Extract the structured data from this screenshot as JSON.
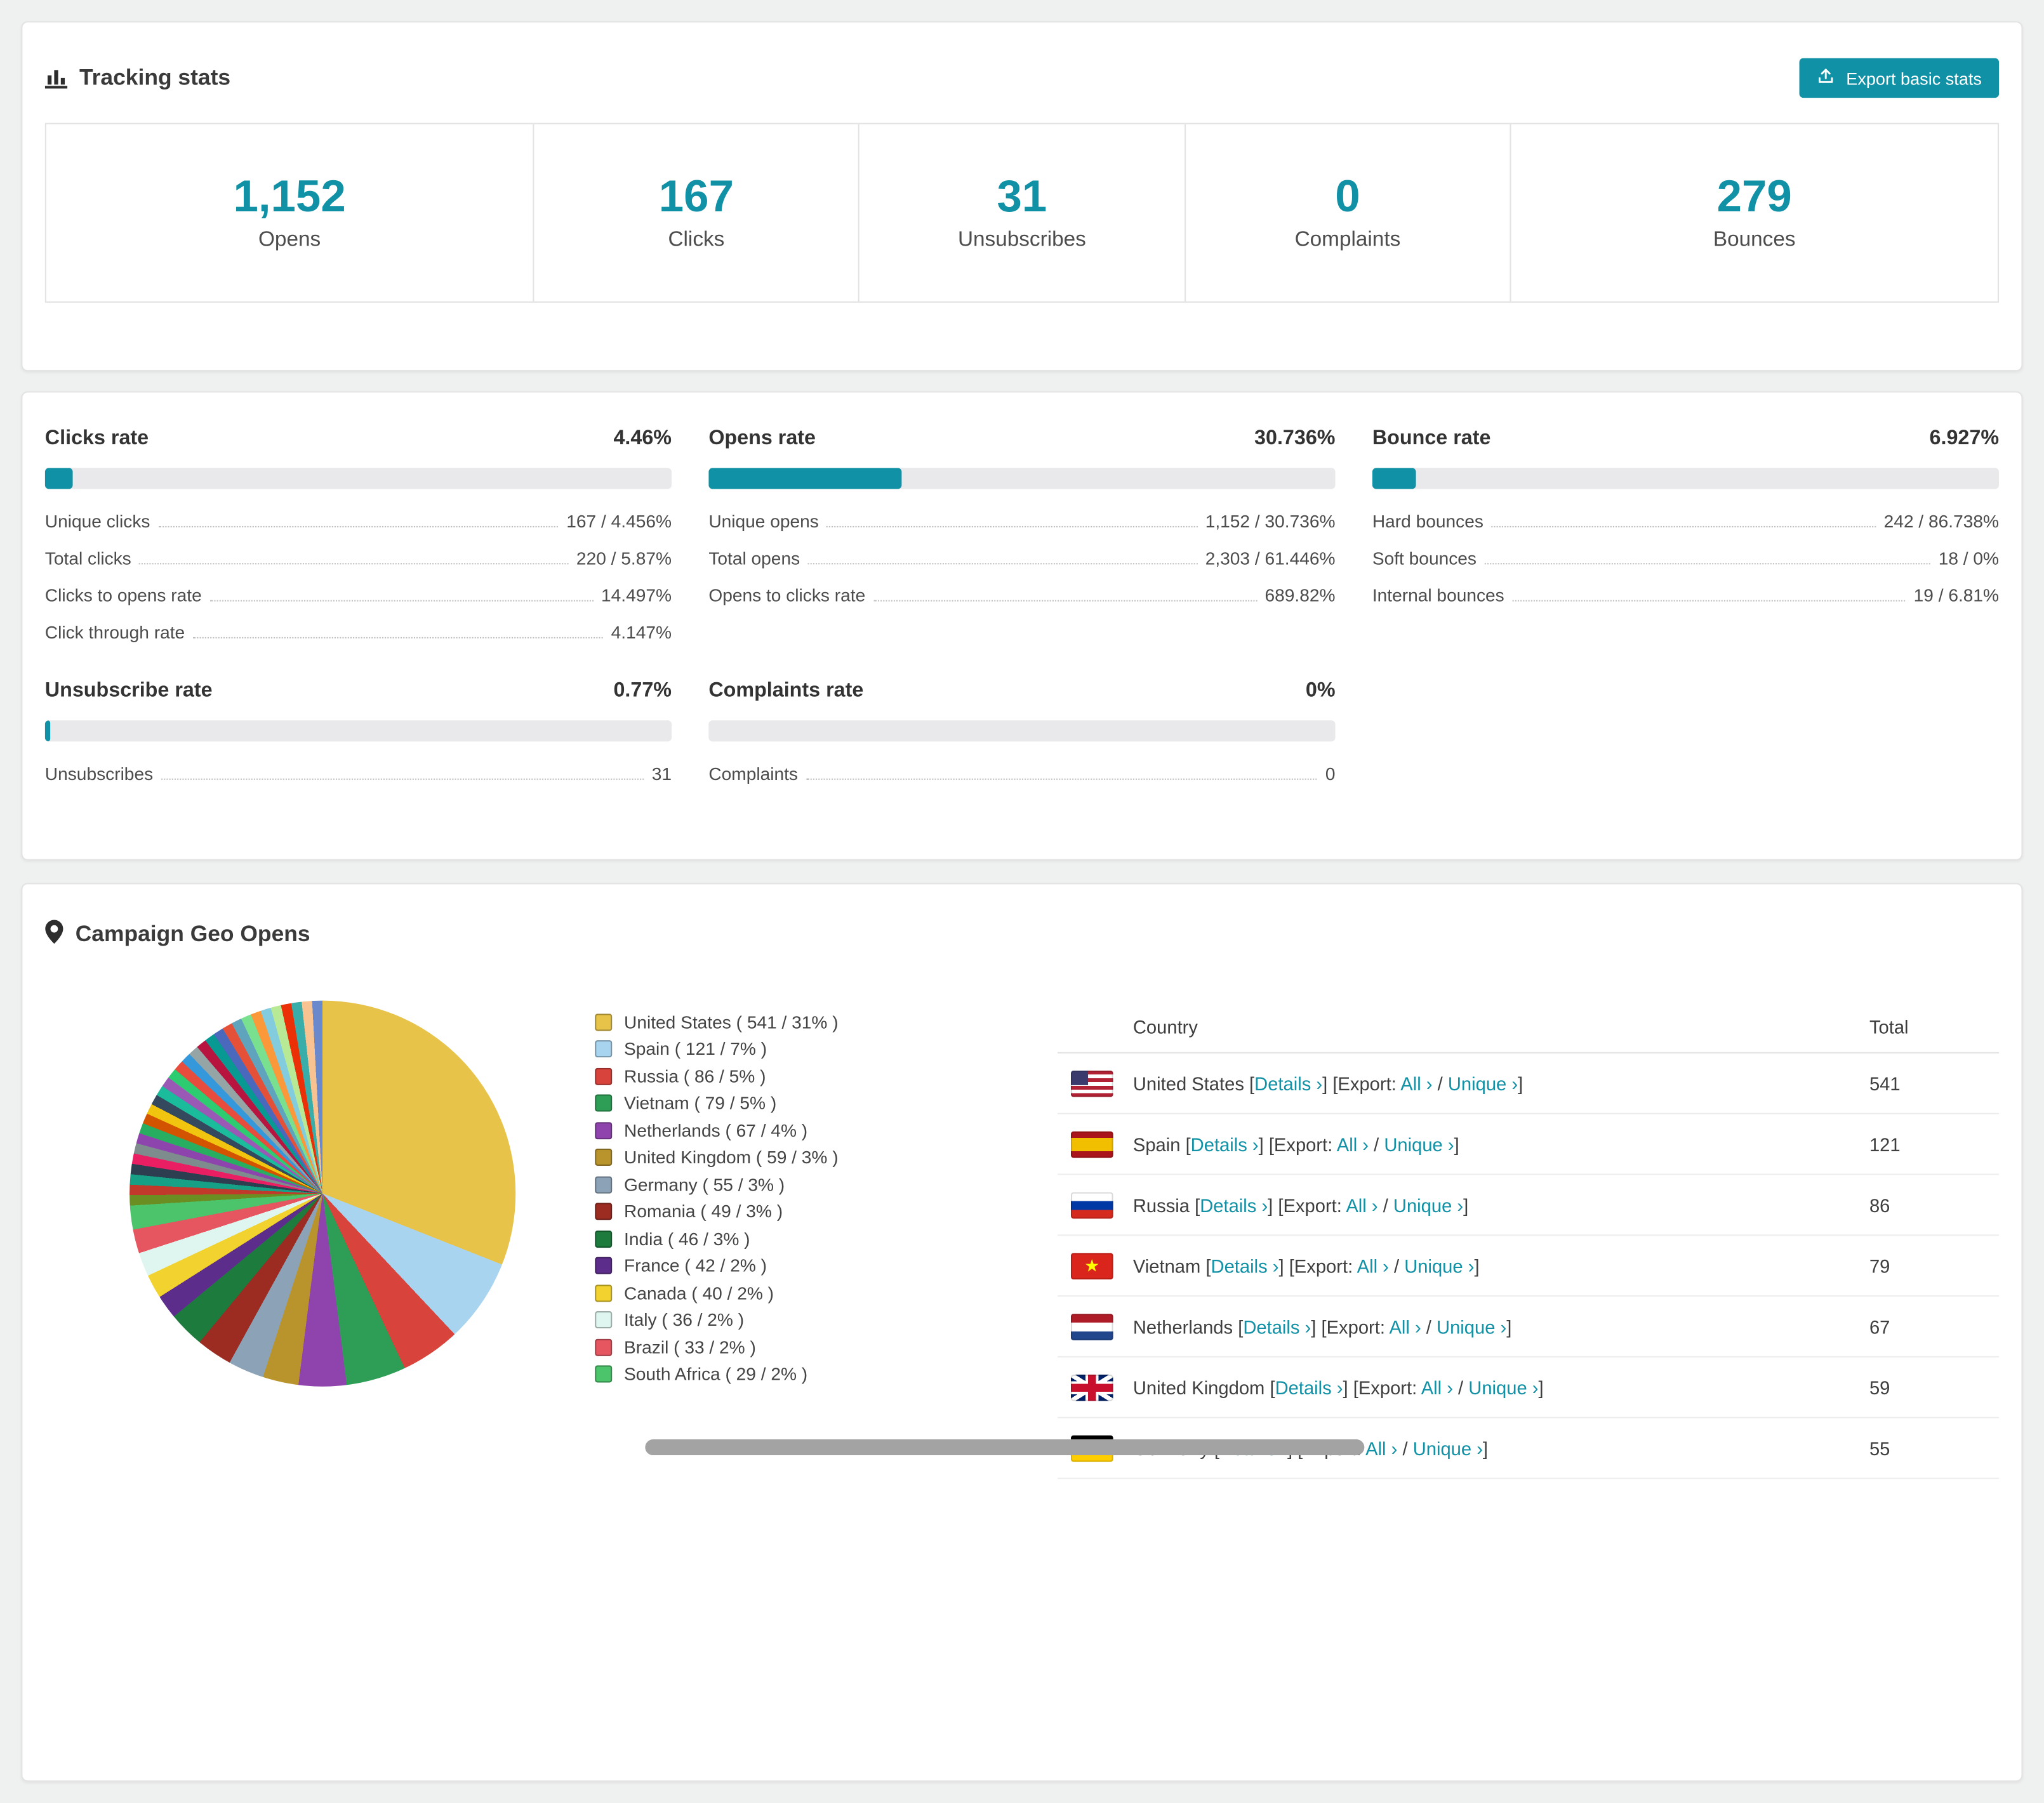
{
  "colors": {
    "accent": "#1191A5",
    "page_bg": "#EFF0F0"
  },
  "tracking": {
    "title": "Tracking stats",
    "export_button": "Export basic stats",
    "stats": [
      {
        "value": "1,152",
        "label": "Opens"
      },
      {
        "value": "167",
        "label": "Clicks"
      },
      {
        "value": "31",
        "label": "Unsubscribes"
      },
      {
        "value": "0",
        "label": "Complaints"
      },
      {
        "value": "279",
        "label": "Bounces"
      }
    ]
  },
  "rates": [
    {
      "title": "Clicks rate",
      "value": "4.46%",
      "pct": 4.46,
      "rows": [
        {
          "label": "Unique clicks",
          "value": "167 / 4.456%"
        },
        {
          "label": "Total clicks",
          "value": "220 / 5.87%"
        },
        {
          "label": "Clicks to opens rate",
          "value": "14.497%"
        },
        {
          "label": "Click through rate",
          "value": "4.147%"
        }
      ]
    },
    {
      "title": "Opens rate",
      "value": "30.736%",
      "pct": 30.736,
      "rows": [
        {
          "label": "Unique opens",
          "value": "1,152 / 30.736%"
        },
        {
          "label": "Total opens",
          "value": "2,303 / 61.446%"
        },
        {
          "label": "Opens to clicks rate",
          "value": "689.82%"
        }
      ]
    },
    {
      "title": "Bounce rate",
      "value": "6.927%",
      "pct": 6.927,
      "rows": [
        {
          "label": "Hard bounces",
          "value": "242 / 86.738%"
        },
        {
          "label": "Soft bounces",
          "value": "18 / 0%"
        },
        {
          "label": "Internal bounces",
          "value": "19 / 6.81%"
        }
      ]
    },
    {
      "title": "Unsubscribe rate",
      "value": "0.77%",
      "pct": 0.77,
      "rows": [
        {
          "label": "Unsubscribes",
          "value": "31"
        }
      ]
    },
    {
      "title": "Complaints rate",
      "value": "0%",
      "pct": 0,
      "rows": [
        {
          "label": "Complaints",
          "value": "0"
        }
      ]
    }
  ],
  "geo": {
    "title": "Campaign Geo Opens",
    "chart_data": {
      "type": "pie",
      "title": "Campaign Geo Opens",
      "slices": [
        {
          "label": "United States",
          "value": 541,
          "pct": 31,
          "color": "#E8C34A"
        },
        {
          "label": "Spain",
          "value": 121,
          "pct": 7,
          "color": "#A8D4F0"
        },
        {
          "label": "Russia",
          "value": 86,
          "pct": 5,
          "color": "#D8433C"
        },
        {
          "label": "Vietnam",
          "value": 79,
          "pct": 5,
          "color": "#2E9E57"
        },
        {
          "label": "Netherlands",
          "value": 67,
          "pct": 4,
          "color": "#8F44AD"
        },
        {
          "label": "United Kingdom",
          "value": 59,
          "pct": 3,
          "color": "#B9932C"
        },
        {
          "label": "Germany",
          "value": 55,
          "pct": 3,
          "color": "#8CA2B6"
        },
        {
          "label": "Romania",
          "value": 49,
          "pct": 3,
          "color": "#9C2B21"
        },
        {
          "label": "India",
          "value": 46,
          "pct": 3,
          "color": "#1E7B3E"
        },
        {
          "label": "France",
          "value": 42,
          "pct": 2,
          "color": "#5D2D8C"
        },
        {
          "label": "Canada",
          "value": 40,
          "pct": 2,
          "color": "#F2D22E"
        },
        {
          "label": "Italy",
          "value": 36,
          "pct": 2,
          "color": "#DFF6F0"
        },
        {
          "label": "Brazil",
          "value": 33,
          "pct": 2,
          "color": "#E65661"
        },
        {
          "label": "South Africa",
          "value": 29,
          "pct": 2,
          "color": "#4BC46B"
        }
      ],
      "other_total_pct": 26,
      "other_colors": [
        "#6B8E23",
        "#C0392B",
        "#16A085",
        "#2C3E50",
        "#E91E63",
        "#7F8C8D",
        "#8E44AD",
        "#27AE60",
        "#D35400",
        "#F1C40F",
        "#34495E",
        "#1ABC9C",
        "#9B59B6",
        "#2ECC71",
        "#E74C3C",
        "#3498DB",
        "#95A5A6",
        "#B71540",
        "#079992",
        "#4A69BD",
        "#E55039",
        "#60A3BC",
        "#78E08F",
        "#FA983A",
        "#82CCDD",
        "#B8E994",
        "#EB2F06",
        "#38ADA9",
        "#F8C291",
        "#6A89CC"
      ],
      "legend_label_format": "{label} ( {value} / {pct}% )"
    },
    "table": {
      "col_country": "Country",
      "col_total": "Total",
      "lb": "[",
      "rb": "]",
      "details_label": "Details ›",
      "export_prefix": "Export:",
      "all_label": "All ›",
      "sep": "/",
      "unique_label": "Unique ›",
      "rows": [
        {
          "country": "United States",
          "flag": "us",
          "total": "541"
        },
        {
          "country": "Spain",
          "flag": "es",
          "total": "121"
        },
        {
          "country": "Russia",
          "flag": "ru",
          "total": "86"
        },
        {
          "country": "Vietnam",
          "flag": "vn",
          "total": "79"
        },
        {
          "country": "Netherlands",
          "flag": "nl",
          "total": "67"
        },
        {
          "country": "United Kingdom",
          "flag": "gb",
          "total": "59"
        },
        {
          "country": "Germany",
          "flag": "de",
          "total": "55"
        }
      ]
    }
  }
}
